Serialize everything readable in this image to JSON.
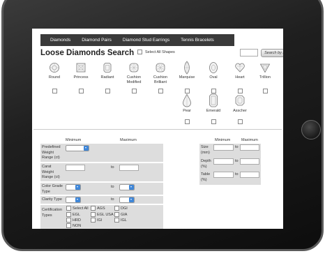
{
  "tabs": [
    "Diamonds",
    "Diamond Pairs",
    "Diamond Stud Earrings",
    "Tennis Bracelets"
  ],
  "title": "Loose Diamonds Search",
  "select_all_shapes": "Select All Shapes",
  "search_by_id": "Search by ID",
  "shapes": [
    "Round",
    "Princess",
    "Radiant",
    "Cushion Modified",
    "Cushion Brilliant",
    "Marquise",
    "Oval",
    "Heart",
    "Trillion",
    "Pear",
    "Emerald",
    "Asscher"
  ],
  "filters": {
    "minimum": "Minimum",
    "maximum": "Maximum",
    "to": "to",
    "predefined_weight": "Predefined Weight Range (ct)",
    "carat_weight": "Carat Weight Range (ct)",
    "color_grade": "Color Grade Type",
    "clarity_type": "Clarity Type",
    "certification": "Certification Types"
  },
  "certs": {
    "select_all": "Select All",
    "ags": "AGS",
    "dgi": "DGI",
    "egl": "EGL",
    "egl_usa": "EGL USA",
    "gia": "GIA",
    "hrd": "HRD",
    "igi": "IGI",
    "igl": "IGL",
    "non": "NON"
  },
  "right_filters": {
    "size": "Size (mm)",
    "depth": "Depth (%)",
    "table": "Table (%)"
  }
}
